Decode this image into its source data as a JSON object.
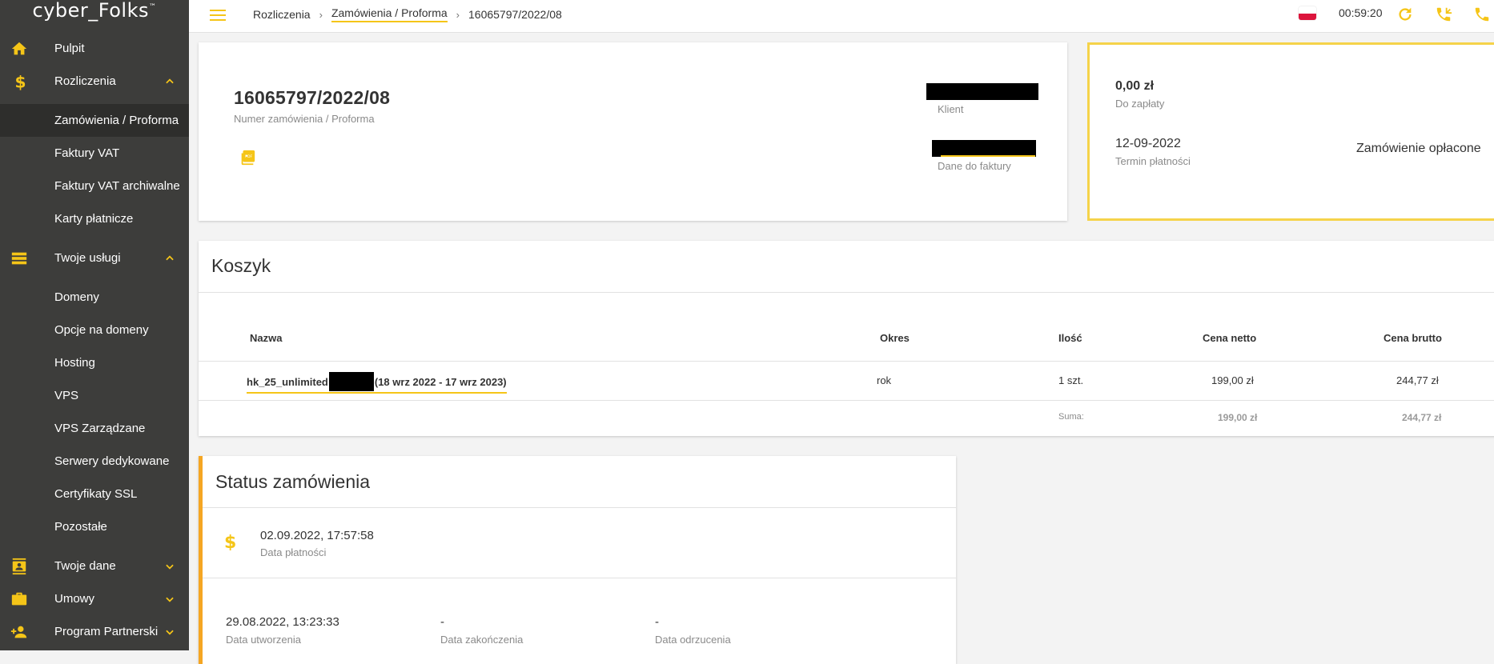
{
  "logo": {
    "text": "cyber_Folks",
    "tm": "™"
  },
  "sidebar": {
    "items": [
      {
        "label": "Pulpit"
      },
      {
        "label": "Rozliczenia"
      },
      {
        "label": "Zamówienia / Proforma"
      },
      {
        "label": "Faktury VAT"
      },
      {
        "label": "Faktury VAT archiwalne"
      },
      {
        "label": "Karty płatnicze"
      },
      {
        "label": "Twoje usługi"
      },
      {
        "label": "Domeny"
      },
      {
        "label": "Opcje na domeny"
      },
      {
        "label": "Hosting"
      },
      {
        "label": "VPS"
      },
      {
        "label": "VPS Zarządzane"
      },
      {
        "label": "Serwery dedykowane"
      },
      {
        "label": "Certyfikaty SSL"
      },
      {
        "label": "Pozostałe"
      },
      {
        "label": "Twoje dane"
      },
      {
        "label": "Umowy"
      },
      {
        "label": "Program Partnerski"
      }
    ]
  },
  "topbar": {
    "breadcrumbs": [
      "Rozliczenia",
      "Zamówienia / Proforma",
      "16065797/2022/08"
    ],
    "timer": "00:59:20"
  },
  "order": {
    "number": "16065797/2022/08",
    "number_label": "Numer zamówienia / Proforma",
    "client_label": "Klient",
    "invoice_data_label": "Dane do faktury"
  },
  "payment": {
    "amount": "0,00 zł",
    "amount_label": "Do zapłaty",
    "due_date": "12-09-2022",
    "due_date_label": "Termin płatności",
    "status": "Zamówienie opłacone"
  },
  "cart": {
    "title": "Koszyk",
    "columns": [
      "Nazwa",
      "Okres",
      "Ilość",
      "Cena netto",
      "Cena brutto"
    ],
    "rows": [
      {
        "name": "hk_25_unlimited",
        "name_suffix": "(18 wrz 2022 - 17 wrz 2023)",
        "period": "rok",
        "qty": "1 szt.",
        "net": "199,00 zł",
        "gross": "244,77 zł"
      }
    ],
    "sum_label": "Suma:",
    "sum_net": "199,00 zł",
    "sum_gross": "244,77 zł"
  },
  "status": {
    "title": "Status zamówienia",
    "payment_date": "02.09.2022, 17:57:58",
    "payment_date_label": "Data płatności",
    "created": "29.08.2022, 13:23:33",
    "created_label": "Data utworzenia",
    "finished": "-",
    "finished_label": "Data zakończenia",
    "rejected": "-",
    "rejected_label": "Data odrzucenia"
  },
  "colors": {
    "accent": "#f5c518",
    "sidebar_bg": "#3d3d3b",
    "status_border": "#f5a623"
  }
}
